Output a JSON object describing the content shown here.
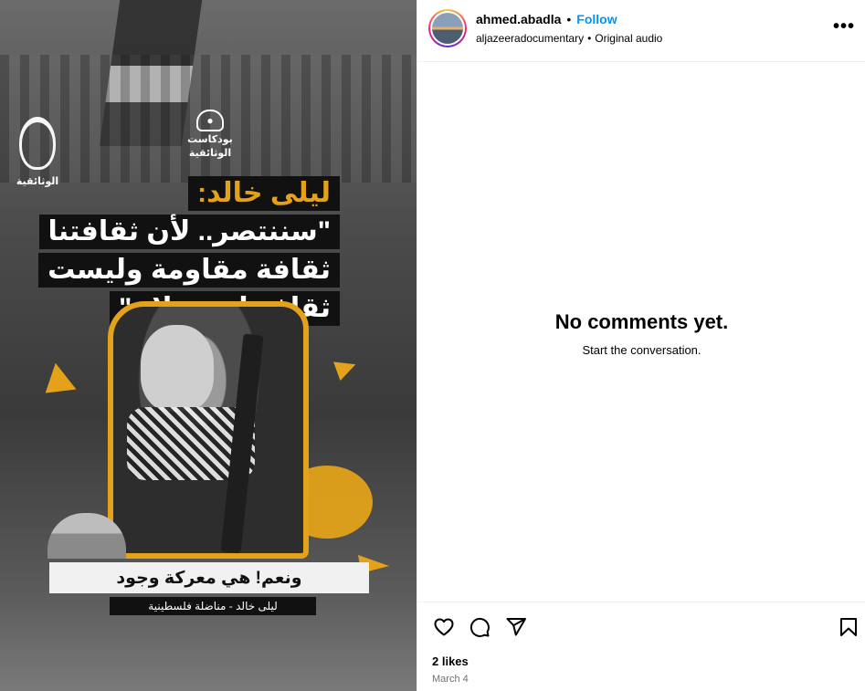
{
  "media": {
    "logo_text": "الوثائقية",
    "podcast_text_1": "بودكاست",
    "podcast_text_2": "الوثائقية",
    "headline_lines": [
      "ليلى خالد:",
      "\"سننتصر.. لأن ثقافتنا",
      "ثقافة مقاومة وليست",
      "ثقافة استسلام\""
    ],
    "quote": "ونعم! هي معركة وجود",
    "attribution": "ليلى خالد - مناضلة فلسطينية",
    "accent_color": "#e3a219"
  },
  "post": {
    "username": "ahmed.abadla",
    "separator": "•",
    "follow_label": "Follow",
    "audio_source": "aljazeeradocumentary",
    "audio_separator": "•",
    "audio_label": "Original audio",
    "more_icon": "more-horizontal-icon",
    "more_label": "•••"
  },
  "comments": {
    "empty_title": "No comments yet.",
    "empty_subtitle": "Start the conversation."
  },
  "actions": {
    "icons": [
      "heart-icon",
      "comment-icon",
      "share-icon",
      "bookmark-icon"
    ],
    "likes": "2 likes",
    "date": "March 4"
  },
  "colors": {
    "follow_blue": "#0095f6",
    "muted_text": "#737373",
    "divider": "#efefef"
  }
}
